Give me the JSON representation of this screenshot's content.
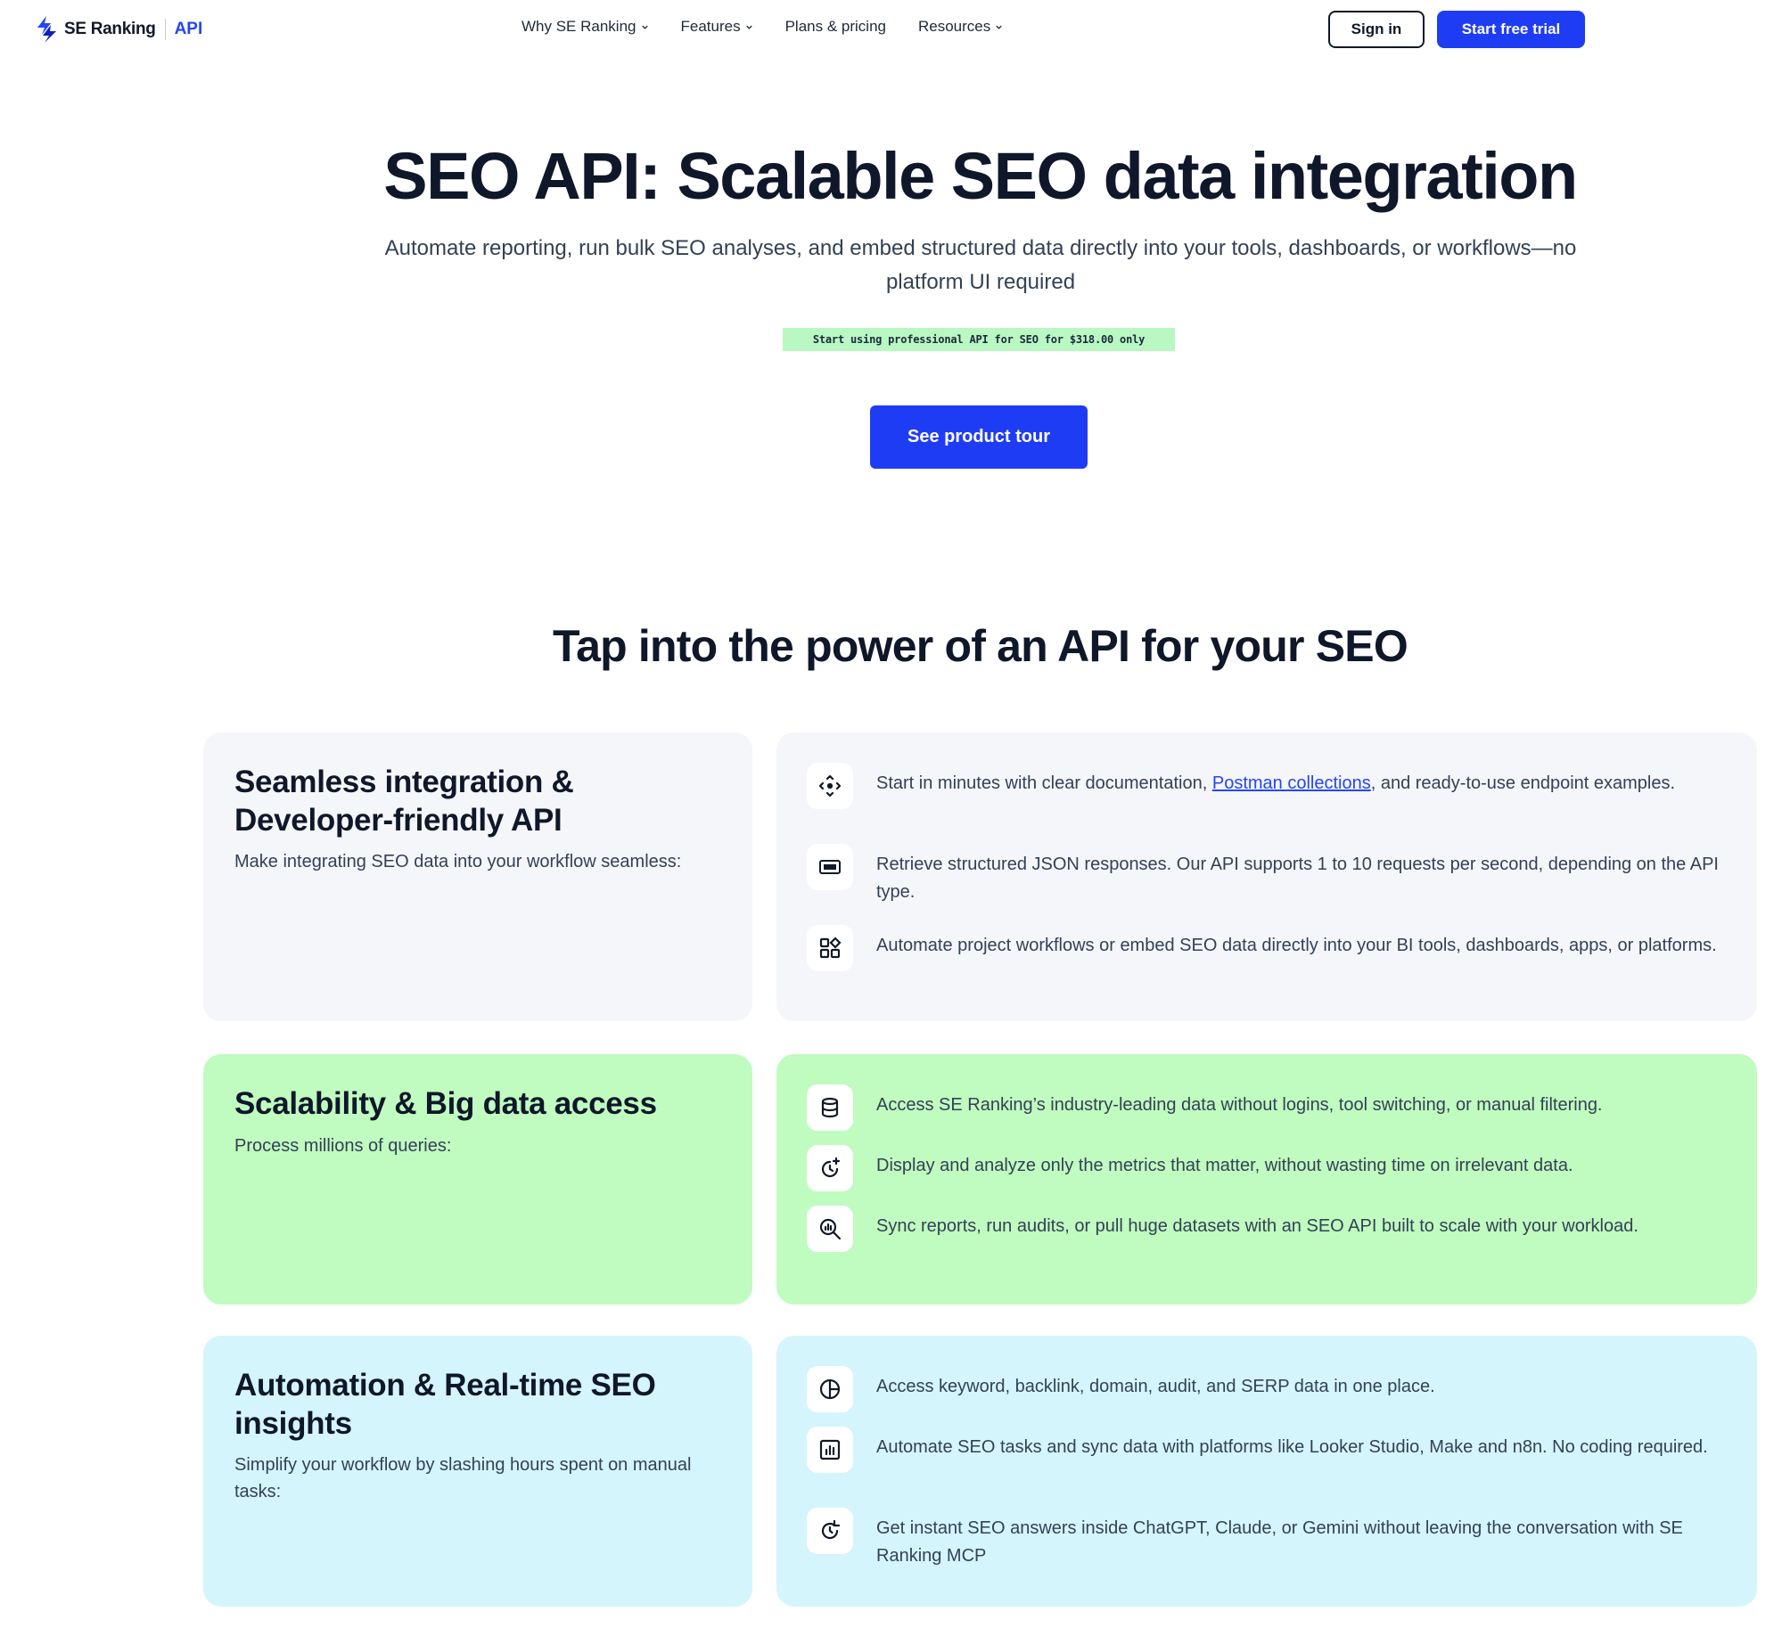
{
  "header": {
    "logo_text": "SE Ranking",
    "logo_api": "API",
    "nav": [
      {
        "label": "Why SE Ranking"
      },
      {
        "label": "Features"
      },
      {
        "label": "Plans & pricing"
      },
      {
        "label": "Resources"
      }
    ],
    "signin_label": "Sign in",
    "trial_label": "Start free trial"
  },
  "hero": {
    "title": "SEO API: Scalable SEO data integration",
    "subtitle": "Automate reporting, run bulk SEO analyses, and embed structured data directly into your tools, dashboards, or workflows—no platform UI required",
    "badge": "Start using professional API for SEO for $318.00 only",
    "cta_label": "See product tour"
  },
  "section_title": "Tap into the power of an API for your SEO",
  "cards": [
    {
      "title": "Seamless integration & Developer-friendly API",
      "desc": "Make integrating SEO data into your workflow seamless:",
      "features": [
        {
          "icon": "move-icon",
          "pre": "Start in minutes with clear documentation, ",
          "link": "Postman collections",
          "post": ", and ready-to-use endpoint examples."
        },
        {
          "icon": "json-icon",
          "text": "Retrieve structured JSON responses. Our API supports 1 to 10 requests per second, depending on the API type."
        },
        {
          "icon": "widgets-icon",
          "text": "Automate project workflows or embed SEO data directly into your BI tools, dashboards, apps, or platforms."
        }
      ]
    },
    {
      "title": "Scalability & Big data access",
      "desc": "Process millions of queries:",
      "features": [
        {
          "icon": "database-icon",
          "text": "Access SE Ranking’s industry-leading data without logins, tool switching, or manual filtering."
        },
        {
          "icon": "clock-plus-icon",
          "text": "Display and analyze only the metrics that matter, without wasting time on irrelevant data."
        },
        {
          "icon": "search-chart-icon",
          "text": "Sync reports, run audits, or pull huge datasets with an SEO API built to scale with your workload."
        }
      ]
    },
    {
      "title": "Automation & Real-time SEO insights",
      "desc": "Simplify your workflow by slashing hours spent on manual tasks:",
      "features": [
        {
          "icon": "pie-chart-icon",
          "text": "Access keyword, backlink, domain, audit, and SERP data in one place."
        },
        {
          "icon": "bar-chart-icon",
          "text": "Automate SEO tasks and sync data with platforms like Looker Studio, Make and n8n. No coding required."
        },
        {
          "icon": "refresh-clock-icon",
          "text": "Get instant SEO answers inside ChatGPT, Claude, or Gemini without leaving the conversation with SE Ranking MCP"
        }
      ]
    }
  ],
  "colors": {
    "brand_blue": "#1f3cf5",
    "card_gray": "#f4f6fa",
    "card_green": "#c0fbc0",
    "card_blue": "#d5f5fc",
    "badge_green": "#b9f7c3"
  }
}
